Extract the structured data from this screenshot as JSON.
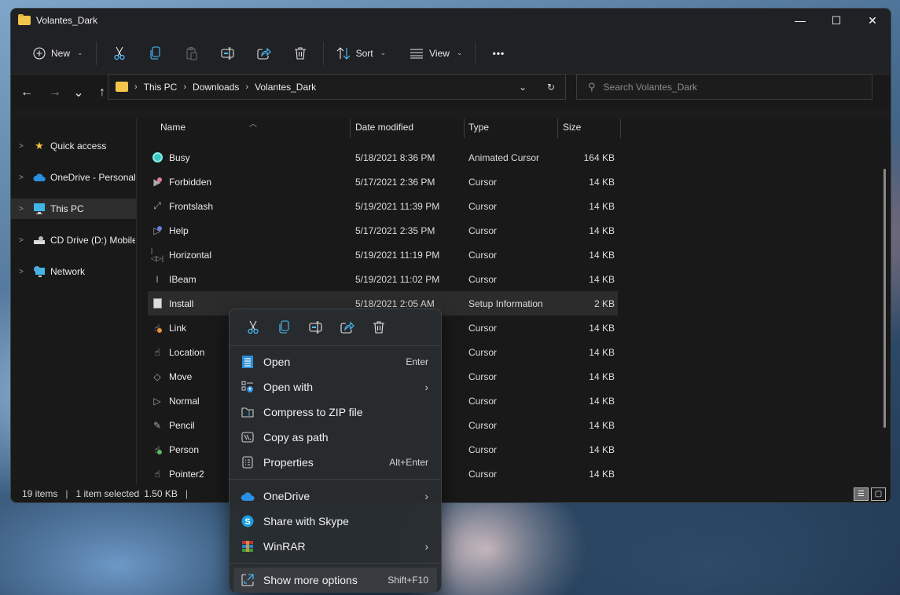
{
  "window": {
    "title": "Volantes_Dark",
    "controls": {
      "minimize": "—",
      "maximize": "☐",
      "close": "✕"
    }
  },
  "toolbar": {
    "new_label": "New",
    "sort_label": "Sort",
    "view_label": "View",
    "more_label": "•••",
    "icons": [
      "cut-icon",
      "copy-icon",
      "paste-icon",
      "rename-icon",
      "share-icon",
      "delete-icon"
    ]
  },
  "navigation": {
    "back": "←",
    "forward": "→",
    "recent": "⌄",
    "up": "↑"
  },
  "address": {
    "crumbs": [
      "This PC",
      "Downloads",
      "Volantes_Dark"
    ],
    "separator": "›"
  },
  "search": {
    "placeholder": "Search Volantes_Dark",
    "value": ""
  },
  "sidebar": {
    "items": [
      {
        "label": "Quick access",
        "icon": "star-icon",
        "active": false
      },
      {
        "label": "OneDrive - Personal",
        "icon": "cloud-icon",
        "active": false
      },
      {
        "label": "This PC",
        "icon": "monitor-icon",
        "active": true
      },
      {
        "label": "CD Drive (D:) Mobile",
        "icon": "cd-drive-icon",
        "active": false
      },
      {
        "label": "Network",
        "icon": "network-icon",
        "active": false
      }
    ]
  },
  "file_list": {
    "columns": [
      "Name",
      "Date modified",
      "Type",
      "Size"
    ],
    "sort_column": "Name",
    "sort_direction": "ascending",
    "rows": [
      {
        "name": "Busy",
        "date": "5/18/2021 8:36 PM",
        "type": "Animated Cursor",
        "size": "164 KB",
        "icon": "busy-cursor-icon",
        "selected": false
      },
      {
        "name": "Forbidden",
        "date": "5/17/2021 2:36 PM",
        "type": "Cursor",
        "size": "14 KB",
        "icon": "forbidden-cursor-icon",
        "selected": false
      },
      {
        "name": "Frontslash",
        "date": "5/19/2021 11:39 PM",
        "type": "Cursor",
        "size": "14 KB",
        "icon": "diagonal-resize-cursor-icon",
        "selected": false
      },
      {
        "name": "Help",
        "date": "5/17/2021 2:35 PM",
        "type": "Cursor",
        "size": "14 KB",
        "icon": "help-cursor-icon",
        "selected": false
      },
      {
        "name": "Horizontal",
        "date": "5/19/2021 11:19 PM",
        "type": "Cursor",
        "size": "14 KB",
        "icon": "horizontal-resize-cursor-icon",
        "selected": false
      },
      {
        "name": "IBeam",
        "date": "5/19/2021 11:02 PM",
        "type": "Cursor",
        "size": "14 KB",
        "icon": "ibeam-cursor-icon",
        "selected": false
      },
      {
        "name": "Install",
        "date": "5/18/2021 2:05 AM",
        "type": "Setup Information",
        "size": "2 KB",
        "icon": "setup-file-icon",
        "selected": true
      },
      {
        "name": "Link",
        "date": "",
        "type": "Cursor",
        "size": "14 KB",
        "icon": "link-cursor-icon",
        "selected": false
      },
      {
        "name": "Location",
        "date": "",
        "type": "Cursor",
        "size": "14 KB",
        "icon": "location-cursor-icon",
        "selected": false
      },
      {
        "name": "Move",
        "date": "",
        "type": "Cursor",
        "size": "14 KB",
        "icon": "move-cursor-icon",
        "selected": false
      },
      {
        "name": "Normal",
        "date": "",
        "type": "Cursor",
        "size": "14 KB",
        "icon": "normal-cursor-icon",
        "selected": false
      },
      {
        "name": "Pencil",
        "date": "",
        "type": "Cursor",
        "size": "14 KB",
        "icon": "pencil-cursor-icon",
        "selected": false
      },
      {
        "name": "Person",
        "date": "",
        "type": "Cursor",
        "size": "14 KB",
        "icon": "person-cursor-icon",
        "selected": false
      },
      {
        "name": "Pointer2",
        "date": "",
        "type": "Cursor",
        "size": "14 KB",
        "icon": "pointer-cursor-icon",
        "selected": false
      }
    ]
  },
  "status": {
    "item_count": "19 items",
    "selection": "1 item selected",
    "selection_size": "1.50 KB"
  },
  "context_menu": {
    "quick_actions": [
      "cut-icon",
      "copy-icon",
      "rename-icon",
      "share-icon",
      "delete-icon"
    ],
    "items": [
      {
        "label": "Open",
        "shortcut": "Enter",
        "submenu": false,
        "icon": "notepad-icon"
      },
      {
        "label": "Open with",
        "shortcut": "",
        "submenu": true,
        "icon": "open-with-icon"
      },
      {
        "label": "Compress to ZIP file",
        "shortcut": "",
        "submenu": false,
        "icon": "zip-folder-icon"
      },
      {
        "label": "Copy as path",
        "shortcut": "",
        "submenu": false,
        "icon": "copy-path-icon"
      },
      {
        "label": "Properties",
        "shortcut": "Alt+Enter",
        "submenu": false,
        "icon": "properties-icon"
      }
    ],
    "extensions": [
      {
        "label": "OneDrive",
        "shortcut": "",
        "submenu": true,
        "icon": "onedrive-icon"
      },
      {
        "label": "Share with Skype",
        "shortcut": "",
        "submenu": false,
        "icon": "skype-icon"
      },
      {
        "label": "WinRAR",
        "shortcut": "",
        "submenu": true,
        "icon": "winrar-icon"
      }
    ],
    "more": {
      "label": "Show more options",
      "shortcut": "Shift+F10",
      "icon": "expand-icon"
    },
    "submenu_arrow": "›"
  },
  "colors": {
    "accent": "#4cc2ff",
    "window_bg": "#1c1c1c",
    "titlebar_bg": "#202124",
    "folder_yellow": "#f3c54a",
    "selection_bg": "#2c2c2c"
  }
}
